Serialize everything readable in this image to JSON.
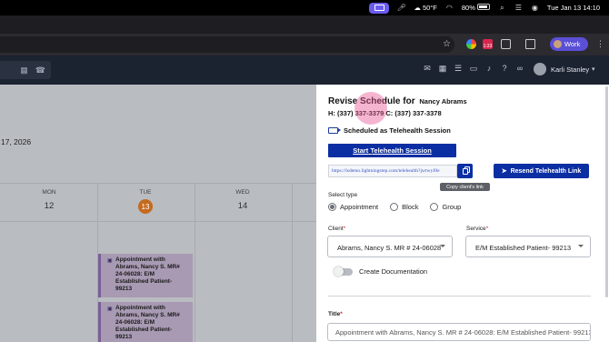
{
  "menubar": {
    "weather": "50°F",
    "battery": "80%",
    "datetime": "Tue Jan 13  14:10"
  },
  "browser": {
    "profile_label": "Work",
    "ext_badge": "1:33"
  },
  "app_header": {
    "user_name": "Karli Stanley"
  },
  "calendar": {
    "date_label": "17, 2026",
    "days": [
      {
        "dow": "MON",
        "num": "12"
      },
      {
        "dow": "TUE",
        "num": "13"
      },
      {
        "dow": "WED",
        "num": "14"
      }
    ],
    "appointments": [
      {
        "text": "Appointment with Abrams, Nancy S. MR# 24-06028: E/M Established Patient- 99213"
      },
      {
        "text": "Appointment with Abrams, Nancy S. MR# 24-06028: E/M Established Patient- 99213"
      }
    ]
  },
  "panel": {
    "title": "Revise Schedule for",
    "client_name": "Nancy Abrams",
    "phones": "H: (337) 337-3379 C: (337) 337-3378",
    "telehealth_status": "Scheduled as Telehealth Session",
    "start_button": "Start Telehealth Session",
    "link_value": "https://lsdemo.lightningstep.com/telehealth?jwtwyJ0e",
    "copy_tooltip": "Copy client's link",
    "resend_button": "Resend Telehealth Link",
    "select_type_label": "Select type",
    "types": [
      {
        "label": "Appointment",
        "selected": true
      },
      {
        "label": "Block",
        "selected": false
      },
      {
        "label": "Group",
        "selected": false
      }
    ],
    "client_label": "Client",
    "client_value": "Abrams, Nancy S. MR # 24-06028",
    "service_label": "Service",
    "service_value": "E/M Established Patient- 99213",
    "create_doc_label": "Create Documentation",
    "title_label": "Title",
    "title_value": "Appointment with Abrams, Nancy S. MR # 24-06028: E/M Established Patient- 99213",
    "required_mark": "*"
  },
  "colors": {
    "primary": "#0b2fa3",
    "header_bg": "#1b2230",
    "today": "#c56a1e",
    "appointment": "#a89ab3"
  }
}
